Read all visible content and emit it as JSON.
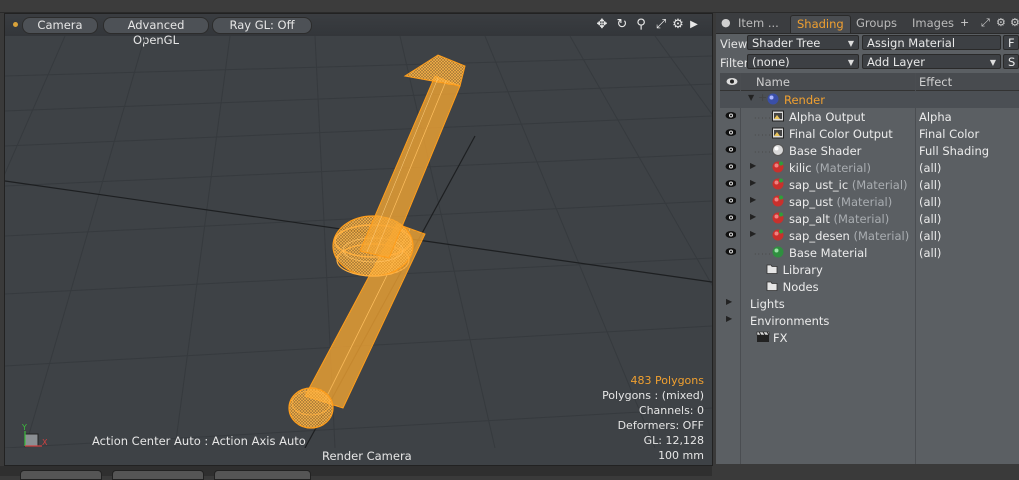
{
  "viewport": {
    "buttons": [
      "Camera",
      "Advanced OpenGL",
      "Ray GL: Off"
    ],
    "toolbar_icons": [
      "move-icon",
      "rotate-icon",
      "search-icon",
      "maximize-icon",
      "gear-icon",
      "play-icon"
    ],
    "stats": {
      "polygons": "483 Polygons",
      "polygons_type": "Polygons : (mixed)",
      "channels": "Channels: 0",
      "deformers": "Deformers: OFF",
      "gl": "GL: 12,128",
      "scale": "100 mm"
    },
    "action_center": "Action Center Auto : Action Axis Auto",
    "camera_label": "Render Camera",
    "axis": {
      "y": "Y",
      "x": "X",
      "z": "Z"
    }
  },
  "panel": {
    "tabs": [
      "Item ...",
      "Shading",
      "Groups",
      "Images"
    ],
    "active_tab": "Shading",
    "view_label": "View",
    "view_value": "Shader Tree",
    "assign_material": "Assign Material",
    "filter_label": "Filter",
    "filter_value": "(none)",
    "add_layer": "Add Layer",
    "right_btn_f": "F",
    "right_btn_s": "S",
    "columns": {
      "name": "Name",
      "effect": "Effect"
    },
    "tree": [
      {
        "name": "Render",
        "suffix": "",
        "effect": "",
        "icon": "render-sphere-icon"
      },
      {
        "name": "Alpha Output",
        "suffix": "",
        "effect": "Alpha",
        "icon": "image-output-icon"
      },
      {
        "name": "Final Color Output",
        "suffix": "",
        "effect": "Final Color",
        "icon": "image-output-icon"
      },
      {
        "name": "Base Shader",
        "suffix": "",
        "effect": "Full Shading",
        "icon": "shader-sphere-icon"
      },
      {
        "name": "kilic",
        "suffix": "(Material)",
        "effect": "(all)",
        "icon": "material-icon"
      },
      {
        "name": "sap_ust_ic",
        "suffix": "(Material)",
        "effect": "(all)",
        "icon": "material-icon"
      },
      {
        "name": "sap_ust",
        "suffix": "(Material)",
        "effect": "(all)",
        "icon": "material-icon"
      },
      {
        "name": "sap_alt",
        "suffix": "(Material)",
        "effect": "(all)",
        "icon": "material-icon"
      },
      {
        "name": "sap_desen",
        "suffix": "(Material)",
        "effect": "(all)",
        "icon": "material-icon"
      },
      {
        "name": "Base Material",
        "suffix": "",
        "effect": "(all)",
        "icon": "base-material-icon"
      },
      {
        "name": "Library",
        "suffix": "",
        "effect": "",
        "icon": "folder-icon"
      },
      {
        "name": "Nodes",
        "suffix": "",
        "effect": "",
        "icon": "folder-icon"
      },
      {
        "name": "Lights",
        "suffix": "",
        "effect": "",
        "icon": ""
      },
      {
        "name": "Environments",
        "suffix": "",
        "effect": "",
        "icon": ""
      },
      {
        "name": "FX",
        "suffix": "",
        "effect": "",
        "icon": "clapper-icon"
      }
    ]
  },
  "colors": {
    "accent": "#f0a030",
    "wire": "#ff9d1a"
  }
}
